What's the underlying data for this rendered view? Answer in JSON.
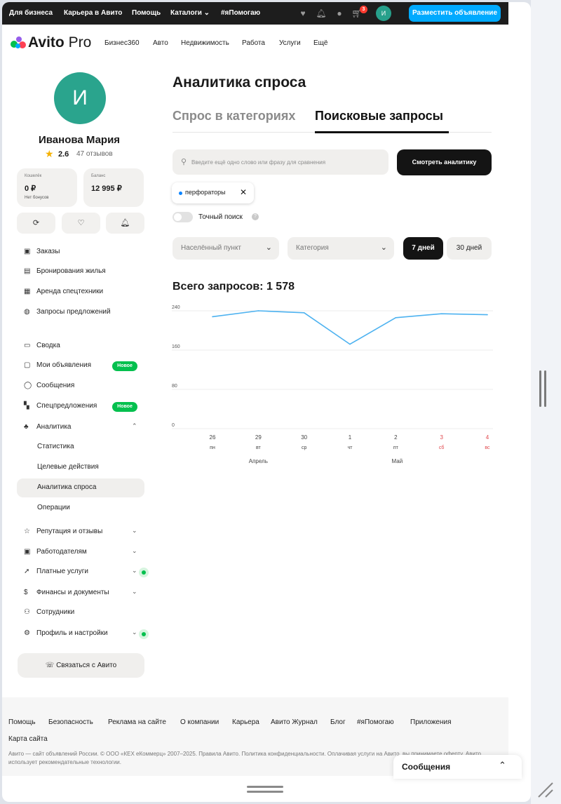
{
  "topbar": {
    "links": [
      "Для бизнеса",
      "Карьера в Авито",
      "Помощь",
      "Каталоги"
    ],
    "hashtag": "#яПомогаю",
    "cart_count": "3",
    "avatar_letter": "И",
    "post_button": "Разместить объявление"
  },
  "nav": {
    "logo_bold": "Avito",
    "logo_light": " Pro",
    "links": [
      "Бизнес360",
      "Авто",
      "Недвижимость",
      "Работа",
      "Услуги",
      "Ещё"
    ]
  },
  "profile": {
    "avatar_letter": "И",
    "name": "Иванова Мария",
    "rating": "2.6",
    "reviews": "47 отзывов",
    "wallet_label": "Кошелёк",
    "wallet_value": "0 ₽",
    "wallet_sub": "Нет бонусов",
    "balance_label": "Баланс",
    "balance_value": "12 995 ₽"
  },
  "menu": {
    "group1": [
      "Заказы",
      "Бронирования жилья",
      "Аренда спецтехники",
      "Запросы предложений"
    ],
    "group2": [
      "Сводка",
      "Мои объявления",
      "Сообщения",
      "Спецпредложения",
      "Аналитика"
    ],
    "new_badge": "Новое",
    "analytics_sub": [
      "Статистика",
      "Целевые действия",
      "Аналитика спроса",
      "Операции"
    ],
    "group3": [
      "Репутация и отзывы",
      "Работодателям",
      "Платные услуги",
      "Финансы и документы",
      "Сотрудники",
      "Профиль и настройки"
    ],
    "contact_button": "Связаться с Авито"
  },
  "main": {
    "title": "Аналитика спроса",
    "tabs": [
      "Спрос в категориях",
      "Поисковые запросы"
    ],
    "search_placeholder": "Введите ещё одно слово или фразу для сравнения",
    "show_button": "Смотреть аналитику",
    "chip": "перфораторы",
    "exact_search": "Точный поиск",
    "location_select": "Населённый пункт",
    "category_select": "Категория",
    "period_7": "7 дней",
    "period_30": "30 дней",
    "total": "Всего запросов: 1 578"
  },
  "chart_data": {
    "type": "line",
    "x": [
      "26 пн",
      "29 вт",
      "30 ср",
      "1 чт",
      "2 пт",
      "3 сб",
      "4 вс"
    ],
    "day_numbers": [
      "26",
      "29",
      "30",
      "1",
      "2",
      "3",
      "4"
    ],
    "weekdays": [
      "пн",
      "вт",
      "ср",
      "чт",
      "пт",
      "сб",
      "вс"
    ],
    "weekend_color": "#e0474c",
    "month_labels": [
      "Апрель",
      "Май"
    ],
    "series": [
      {
        "values": [
          228,
          240,
          236,
          172,
          226,
          234,
          232
        ],
        "color": "#4db2f0"
      }
    ],
    "yticks": [
      "240",
      "160",
      "80",
      "0"
    ],
    "ylim": [
      0,
      240
    ]
  },
  "footer": {
    "links": [
      "Помощь",
      "Безопасность",
      "Реклама на сайте",
      "О компании",
      "Карьера",
      "Авито Журнал",
      "Блог",
      "#яПомогаю",
      "Приложения"
    ],
    "sitemap": "Карта сайта",
    "legal": "Авито — сайт объявлений России. © ООО «КЕХ еКоммерц» 2007–2025. Правила Авито. Политика конфиденциальности. Оплачивая услуги на Авито, вы принимаете оферту. Авито использует рекомендательные технологии."
  },
  "messages_panel": "Сообщения"
}
